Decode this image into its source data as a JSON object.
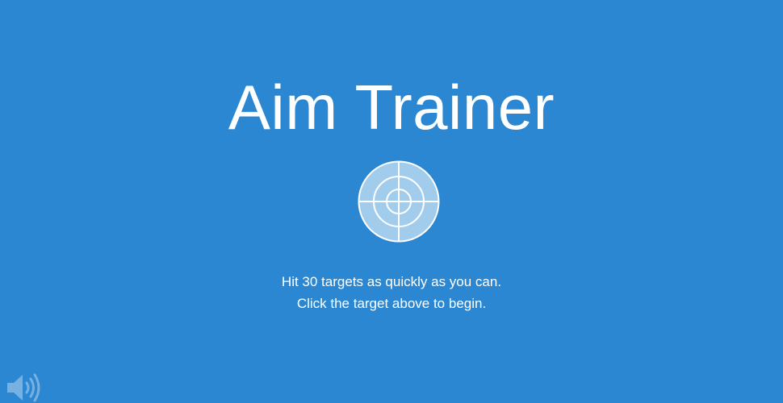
{
  "game": {
    "title": "Aim Trainer",
    "instruction_line1": "Hit 30 targets as quickly as you can.",
    "instruction_line2": "Click the target above to begin."
  },
  "target": {
    "icon": "target-icon",
    "fill_color": "#a2ccec",
    "line_color": "#ffffff"
  },
  "sound": {
    "icon": "speaker-icon",
    "color": "#77b1e2"
  },
  "colors": {
    "background": "#2b87d1",
    "text": "#ffffff"
  }
}
